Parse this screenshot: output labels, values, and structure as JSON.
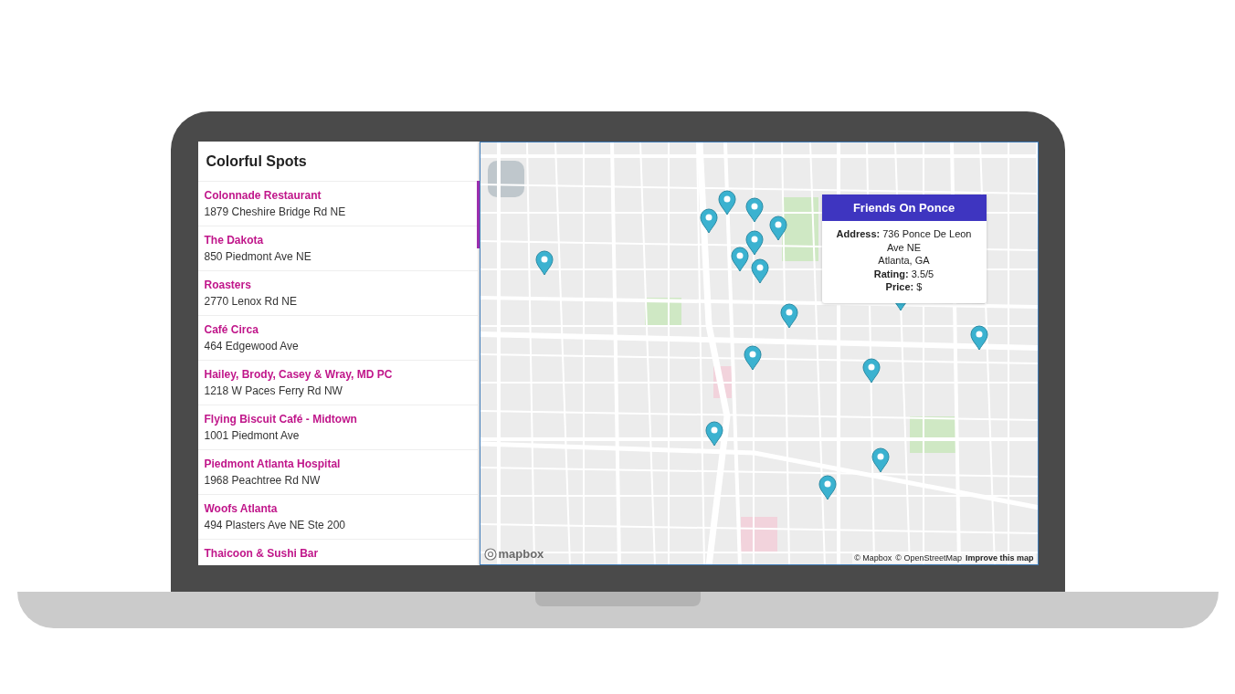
{
  "sidebar": {
    "title": "Colorful Spots",
    "places": [
      {
        "name": "Colonnade Restaurant",
        "address": "1879 Cheshire Bridge Rd NE"
      },
      {
        "name": "The Dakota",
        "address": "850 Piedmont Ave NE"
      },
      {
        "name": "Roasters",
        "address": "2770 Lenox Rd NE"
      },
      {
        "name": "Café Circa",
        "address": "464 Edgewood Ave"
      },
      {
        "name": "Hailey, Brody, Casey & Wray, MD PC",
        "address": "1218 W Paces Ferry Rd NW"
      },
      {
        "name": "Flying Biscuit Café - Midtown",
        "address": "1001 Piedmont Ave"
      },
      {
        "name": "Piedmont Atlanta Hospital",
        "address": "1968 Peachtree Rd NW"
      },
      {
        "name": "Woofs Atlanta",
        "address": "494 Plasters Ave NE Ste 200"
      },
      {
        "name": "Thaicoon & Sushi Bar"
      }
    ]
  },
  "map": {
    "popup": {
      "title": "Friends On Ponce",
      "lines": [
        "**Address:** 736 Ponce De Leon Ave NE",
        "Atlanta, GA",
        "**Rating:** 3.5/5",
        "**Price:** $"
      ]
    },
    "logo": "mapbox",
    "attribution": [
      "© Mapbox",
      "© OpenStreetMap"
    ],
    "improve_link": "Improve this map"
  }
}
